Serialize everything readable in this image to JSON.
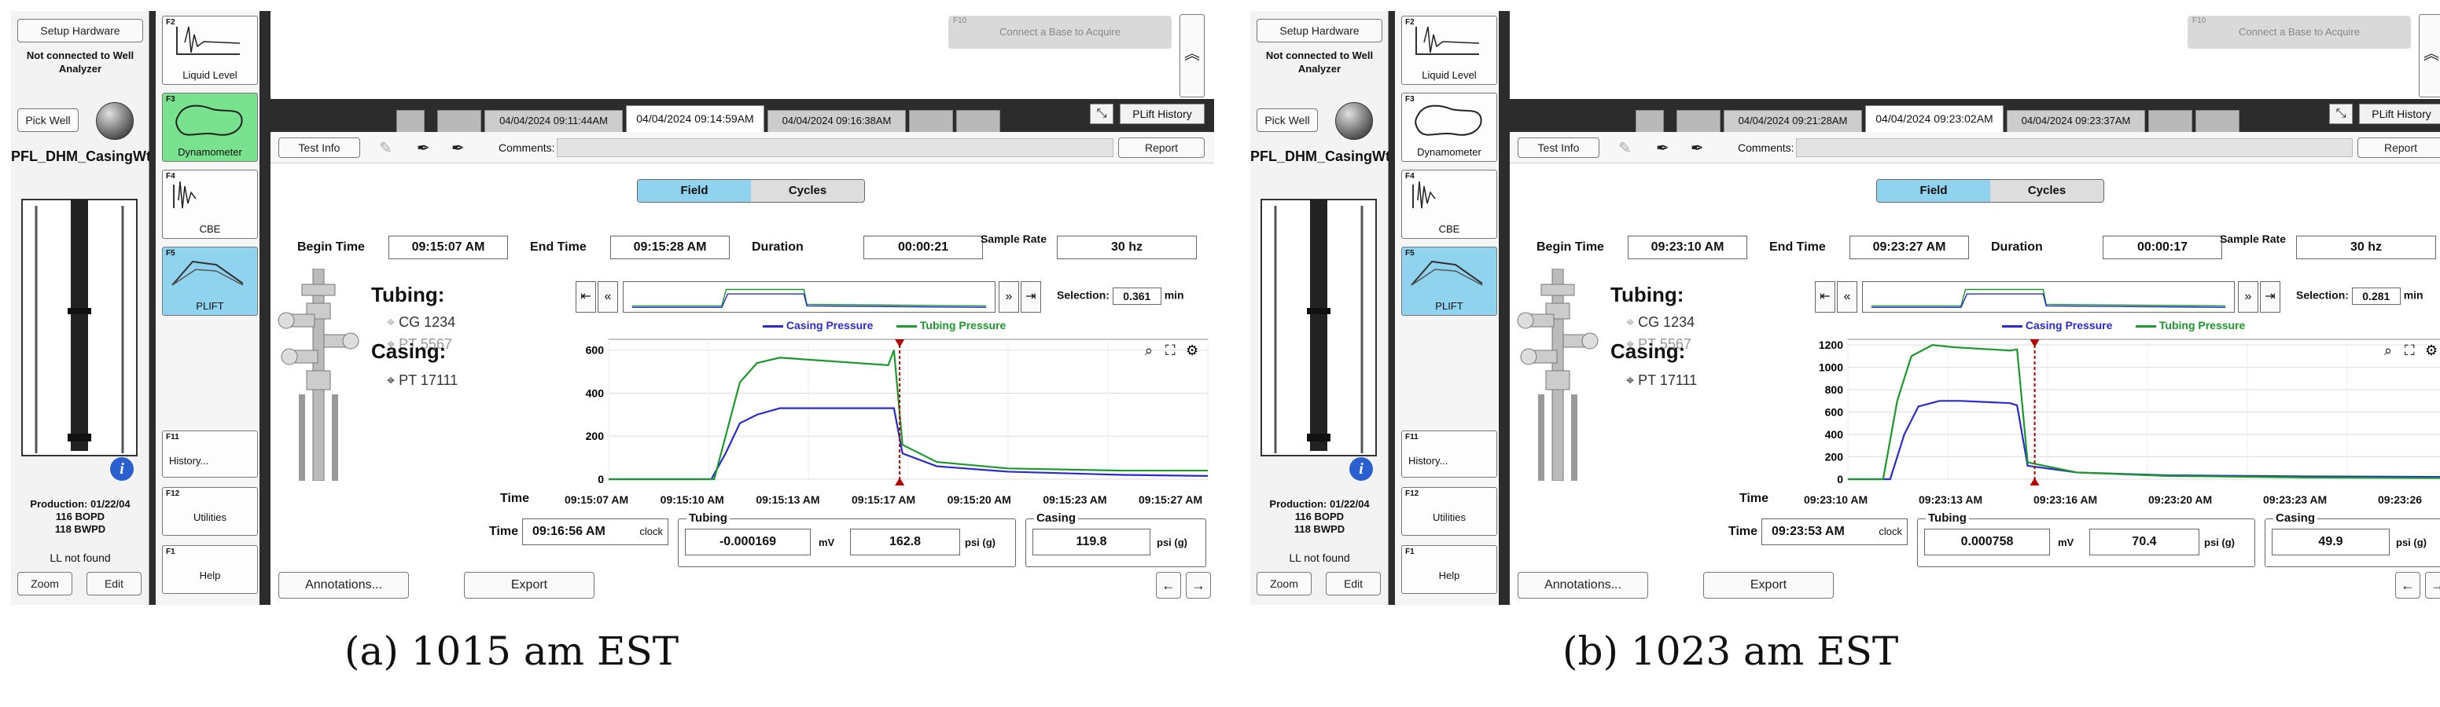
{
  "panels": {
    "a": {
      "setup_hardware": "Setup Hardware",
      "not_connected": "Not connected to Well Analyzer",
      "pick_well": "Pick Well",
      "well_name": "PFL_DHM_CasingWtChange",
      "production": "Production: 01/22/04",
      "bopd": "116 BOPD",
      "bwpd": "118 BWPD",
      "ll_status": "LL not found",
      "zoom": "Zoom",
      "edit": "Edit",
      "tools": [
        {
          "key": "F2",
          "label": "Liquid Level"
        },
        {
          "key": "F3",
          "label": "Dynamometer"
        },
        {
          "key": "F4",
          "label": "CBE"
        },
        {
          "key": "F5",
          "label": "PLIFT"
        }
      ],
      "history": {
        "key": "F11",
        "label": "History..."
      },
      "utilities": {
        "key": "F12",
        "label": "Utilities"
      },
      "help": {
        "key": "F1",
        "label": "Help"
      },
      "acquire": {
        "key": "F10",
        "label": "Connect a Base to Acquire"
      },
      "tabs": [
        "04/04/2024 09:11:44AM",
        "04/04/2024 09:14:59AM",
        "04/04/2024 09:16:38AM"
      ],
      "plift_history": "PLift History",
      "test_info": "Test Info",
      "comments_label": "Comments:",
      "report": "Report",
      "mode_field": "Field",
      "mode_cycles": "Cycles",
      "begin_time_label": "Begin Time",
      "begin_time": "09:15:07 AM",
      "end_time_label": "End Time",
      "end_time": "09:15:28 AM",
      "duration_label": "Duration",
      "duration": "00:00:21",
      "sample_rate_label": "Sample Rate",
      "sample_rate": "30 hz",
      "tubing_title": "Tubing:",
      "tubing_cg": "CG 1234",
      "tubing_pt": "PT 5567",
      "casing_title": "Casing:",
      "casing_pt": "PT 17111",
      "selection_label": "Selection:",
      "selection_value": "0.361",
      "selection_unit": "min",
      "legend_casing": "Casing Pressure",
      "legend_tubing": "Tubing Pressure",
      "time_label": "Time",
      "xticks": [
        "09:15:07 AM",
        "09:15:10 AM",
        "09:15:13 AM",
        "09:15:17 AM",
        "09:15:20 AM",
        "09:15:23 AM",
        "09:15:27 AM"
      ],
      "clock_label": "Time",
      "clock_time": "09:16:56 AM",
      "clock_unit": "clock",
      "tubing_group": "Tubing",
      "tubing_mv": "-0.000169",
      "tubing_mv_unit": "mV",
      "tubing_psi": "162.8",
      "tubing_psi_unit": "psi (g)",
      "casing_group": "Casing",
      "casing_psi": "119.8",
      "casing_psi_unit": "psi (g)",
      "annotations": "Annotations...",
      "export": "Export",
      "caption": "(a) 1015 am EST"
    },
    "b": {
      "setup_hardware": "Setup Hardware",
      "not_connected": "Not connected to Well Analyzer",
      "pick_well": "Pick Well",
      "well_name": "PFL_DHM_CasingWtChange",
      "production": "Production: 01/22/04",
      "bopd": "116 BOPD",
      "bwpd": "118 BWPD",
      "ll_status": "LL not found",
      "zoom": "Zoom",
      "edit": "Edit",
      "tools": [
        {
          "key": "F2",
          "label": "Liquid Level"
        },
        {
          "key": "F3",
          "label": "Dynamometer"
        },
        {
          "key": "F4",
          "label": "CBE"
        },
        {
          "key": "F5",
          "label": "PLIFT"
        }
      ],
      "history": {
        "key": "F11",
        "label": "History..."
      },
      "utilities": {
        "key": "F12",
        "label": "Utilities"
      },
      "help": {
        "key": "F1",
        "label": "Help"
      },
      "acquire": {
        "key": "F10",
        "label": "Connect a Base to Acquire"
      },
      "tabs": [
        "04/04/2024 09:21:28AM",
        "04/04/2024 09:23:02AM",
        "04/04/2024 09:23:37AM"
      ],
      "plift_history": "PLift History",
      "test_info": "Test Info",
      "comments_label": "Comments:",
      "report": "Report",
      "mode_field": "Field",
      "mode_cycles": "Cycles",
      "begin_time_label": "Begin Time",
      "begin_time": "09:23:10 AM",
      "end_time_label": "End Time",
      "end_time": "09:23:27 AM",
      "duration_label": "Duration",
      "duration": "00:00:17",
      "sample_rate_label": "Sample Rate",
      "sample_rate": "30 hz",
      "tubing_title": "Tubing:",
      "tubing_cg": "CG 1234",
      "tubing_pt": "PT 5567",
      "casing_title": "Casing:",
      "casing_pt": "PT 17111",
      "selection_label": "Selection:",
      "selection_value": "0.281",
      "selection_unit": "min",
      "legend_casing": "Casing Pressure",
      "legend_tubing": "Tubing Pressure",
      "time_label": "Time",
      "xticks": [
        "09:23:10 AM",
        "09:23:13 AM",
        "09:23:16 AM",
        "09:23:20 AM",
        "09:23:23 AM",
        "09:23:26"
      ],
      "clock_label": "Time",
      "clock_time": "09:23:53 AM",
      "clock_unit": "clock",
      "tubing_group": "Tubing",
      "tubing_mv": "0.000758",
      "tubing_mv_unit": "mV",
      "tubing_psi": "70.4",
      "tubing_psi_unit": "psi (g)",
      "casing_group": "Casing",
      "casing_psi": "49.9",
      "casing_psi_unit": "psi (g)",
      "annotations": "Annotations...",
      "export": "Export",
      "caption": "(b) 1023 am EST"
    }
  },
  "colors": {
    "casing": "#2a2ad0",
    "tubing": "#1a9a2a",
    "cursor": "#b00000",
    "field_on": "#8fd3ee",
    "dyn_green": "#78e28e"
  },
  "chart_data": [
    {
      "type": "line",
      "ylim": [
        0,
        650
      ],
      "yticks": [
        0,
        200,
        400,
        600
      ],
      "xlim": [
        0,
        21
      ],
      "cursor_x": 10.2,
      "series": [
        {
          "name": "Casing Pressure",
          "x": [
            0,
            3.6,
            4.1,
            4.6,
            5.2,
            6.0,
            9.8,
            10.0,
            10.3,
            11.5,
            14,
            18,
            21
          ],
          "values": [
            0,
            0,
            120,
            260,
            300,
            330,
            330,
            330,
            120,
            60,
            35,
            20,
            15
          ]
        },
        {
          "name": "Tubing Pressure",
          "x": [
            0,
            3.7,
            4.1,
            4.6,
            5.2,
            6.0,
            9.8,
            10.0,
            10.3,
            11.5,
            14,
            18,
            21
          ],
          "values": [
            0,
            0,
            200,
            450,
            540,
            565,
            530,
            600,
            160,
            80,
            50,
            40,
            40
          ]
        }
      ]
    },
    {
      "type": "line",
      "ylim": [
        0,
        1250
      ],
      "yticks": [
        0,
        200,
        400,
        600,
        800,
        1000,
        1200
      ],
      "xlim": [
        0,
        17
      ],
      "cursor_x": 5.3,
      "series": [
        {
          "name": "Casing Pressure",
          "x": [
            0,
            1.2,
            1.6,
            2.0,
            2.6,
            3.2,
            4.6,
            4.8,
            5.1,
            6.5,
            9,
            13,
            17
          ],
          "values": [
            0,
            0,
            400,
            650,
            700,
            700,
            680,
            660,
            120,
            60,
            35,
            25,
            20
          ]
        },
        {
          "name": "Tubing Pressure",
          "x": [
            0,
            1.0,
            1.4,
            1.8,
            2.4,
            3.0,
            4.6,
            4.8,
            5.1,
            6.5,
            9,
            13,
            17
          ],
          "values": [
            0,
            0,
            700,
            1100,
            1200,
            1180,
            1150,
            1160,
            150,
            60,
            30,
            15,
            10
          ]
        }
      ]
    }
  ]
}
